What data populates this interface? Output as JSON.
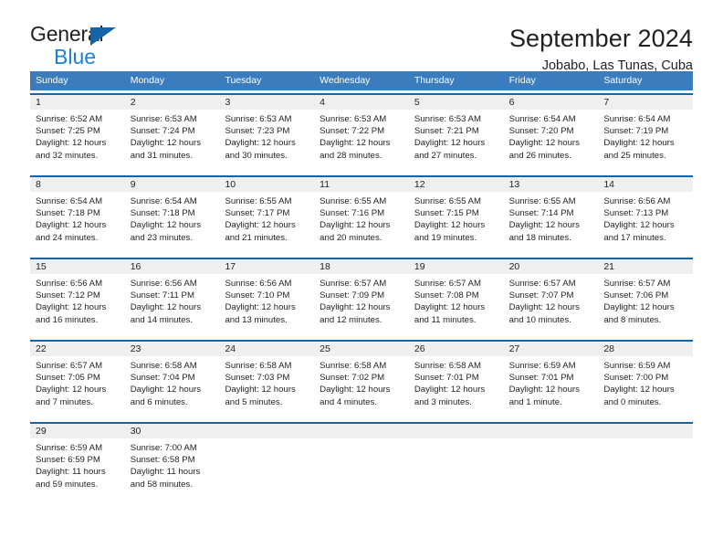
{
  "brand": {
    "word_one": "General",
    "word_two": "Blue",
    "triangle_icon": "brand-triangle-icon"
  },
  "header": {
    "title": "September 2024",
    "subtitle": "Jobabo, Las Tunas, Cuba"
  },
  "calendar": {
    "day_headers": [
      "Sunday",
      "Monday",
      "Tuesday",
      "Wednesday",
      "Thursday",
      "Friday",
      "Saturday"
    ],
    "weeks": [
      [
        {
          "day": "1",
          "lines": [
            "Sunrise: 6:52 AM",
            "Sunset: 7:25 PM",
            "Daylight: 12 hours",
            "and 32 minutes."
          ]
        },
        {
          "day": "2",
          "lines": [
            "Sunrise: 6:53 AM",
            "Sunset: 7:24 PM",
            "Daylight: 12 hours",
            "and 31 minutes."
          ]
        },
        {
          "day": "3",
          "lines": [
            "Sunrise: 6:53 AM",
            "Sunset: 7:23 PM",
            "Daylight: 12 hours",
            "and 30 minutes."
          ]
        },
        {
          "day": "4",
          "lines": [
            "Sunrise: 6:53 AM",
            "Sunset: 7:22 PM",
            "Daylight: 12 hours",
            "and 28 minutes."
          ]
        },
        {
          "day": "5",
          "lines": [
            "Sunrise: 6:53 AM",
            "Sunset: 7:21 PM",
            "Daylight: 12 hours",
            "and 27 minutes."
          ]
        },
        {
          "day": "6",
          "lines": [
            "Sunrise: 6:54 AM",
            "Sunset: 7:20 PM",
            "Daylight: 12 hours",
            "and 26 minutes."
          ]
        },
        {
          "day": "7",
          "lines": [
            "Sunrise: 6:54 AM",
            "Sunset: 7:19 PM",
            "Daylight: 12 hours",
            "and 25 minutes."
          ]
        }
      ],
      [
        {
          "day": "8",
          "lines": [
            "Sunrise: 6:54 AM",
            "Sunset: 7:18 PM",
            "Daylight: 12 hours",
            "and 24 minutes."
          ]
        },
        {
          "day": "9",
          "lines": [
            "Sunrise: 6:54 AM",
            "Sunset: 7:18 PM",
            "Daylight: 12 hours",
            "and 23 minutes."
          ]
        },
        {
          "day": "10",
          "lines": [
            "Sunrise: 6:55 AM",
            "Sunset: 7:17 PM",
            "Daylight: 12 hours",
            "and 21 minutes."
          ]
        },
        {
          "day": "11",
          "lines": [
            "Sunrise: 6:55 AM",
            "Sunset: 7:16 PM",
            "Daylight: 12 hours",
            "and 20 minutes."
          ]
        },
        {
          "day": "12",
          "lines": [
            "Sunrise: 6:55 AM",
            "Sunset: 7:15 PM",
            "Daylight: 12 hours",
            "and 19 minutes."
          ]
        },
        {
          "day": "13",
          "lines": [
            "Sunrise: 6:55 AM",
            "Sunset: 7:14 PM",
            "Daylight: 12 hours",
            "and 18 minutes."
          ]
        },
        {
          "day": "14",
          "lines": [
            "Sunrise: 6:56 AM",
            "Sunset: 7:13 PM",
            "Daylight: 12 hours",
            "and 17 minutes."
          ]
        }
      ],
      [
        {
          "day": "15",
          "lines": [
            "Sunrise: 6:56 AM",
            "Sunset: 7:12 PM",
            "Daylight: 12 hours",
            "and 16 minutes."
          ]
        },
        {
          "day": "16",
          "lines": [
            "Sunrise: 6:56 AM",
            "Sunset: 7:11 PM",
            "Daylight: 12 hours",
            "and 14 minutes."
          ]
        },
        {
          "day": "17",
          "lines": [
            "Sunrise: 6:56 AM",
            "Sunset: 7:10 PM",
            "Daylight: 12 hours",
            "and 13 minutes."
          ]
        },
        {
          "day": "18",
          "lines": [
            "Sunrise: 6:57 AM",
            "Sunset: 7:09 PM",
            "Daylight: 12 hours",
            "and 12 minutes."
          ]
        },
        {
          "day": "19",
          "lines": [
            "Sunrise: 6:57 AM",
            "Sunset: 7:08 PM",
            "Daylight: 12 hours",
            "and 11 minutes."
          ]
        },
        {
          "day": "20",
          "lines": [
            "Sunrise: 6:57 AM",
            "Sunset: 7:07 PM",
            "Daylight: 12 hours",
            "and 10 minutes."
          ]
        },
        {
          "day": "21",
          "lines": [
            "Sunrise: 6:57 AM",
            "Sunset: 7:06 PM",
            "Daylight: 12 hours",
            "and 8 minutes."
          ]
        }
      ],
      [
        {
          "day": "22",
          "lines": [
            "Sunrise: 6:57 AM",
            "Sunset: 7:05 PM",
            "Daylight: 12 hours",
            "and 7 minutes."
          ]
        },
        {
          "day": "23",
          "lines": [
            "Sunrise: 6:58 AM",
            "Sunset: 7:04 PM",
            "Daylight: 12 hours",
            "and 6 minutes."
          ]
        },
        {
          "day": "24",
          "lines": [
            "Sunrise: 6:58 AM",
            "Sunset: 7:03 PM",
            "Daylight: 12 hours",
            "and 5 minutes."
          ]
        },
        {
          "day": "25",
          "lines": [
            "Sunrise: 6:58 AM",
            "Sunset: 7:02 PM",
            "Daylight: 12 hours",
            "and 4 minutes."
          ]
        },
        {
          "day": "26",
          "lines": [
            "Sunrise: 6:58 AM",
            "Sunset: 7:01 PM",
            "Daylight: 12 hours",
            "and 3 minutes."
          ]
        },
        {
          "day": "27",
          "lines": [
            "Sunrise: 6:59 AM",
            "Sunset: 7:01 PM",
            "Daylight: 12 hours",
            "and 1 minute."
          ]
        },
        {
          "day": "28",
          "lines": [
            "Sunrise: 6:59 AM",
            "Sunset: 7:00 PM",
            "Daylight: 12 hours",
            "and 0 minutes."
          ]
        }
      ],
      [
        {
          "day": "29",
          "lines": [
            "Sunrise: 6:59 AM",
            "Sunset: 6:59 PM",
            "Daylight: 11 hours",
            "and 59 minutes."
          ]
        },
        {
          "day": "30",
          "lines": [
            "Sunrise: 7:00 AM",
            "Sunset: 6:58 PM",
            "Daylight: 11 hours",
            "and 58 minutes."
          ]
        },
        {
          "day": "",
          "lines": []
        },
        {
          "day": "",
          "lines": []
        },
        {
          "day": "",
          "lines": []
        },
        {
          "day": "",
          "lines": []
        },
        {
          "day": "",
          "lines": []
        }
      ]
    ]
  },
  "colors": {
    "header_blue": "#3a7cbe",
    "rule_blue": "#1464aa",
    "brand_blue": "#1b7fd4",
    "day_band": "#efefef",
    "text": "#231f20"
  }
}
